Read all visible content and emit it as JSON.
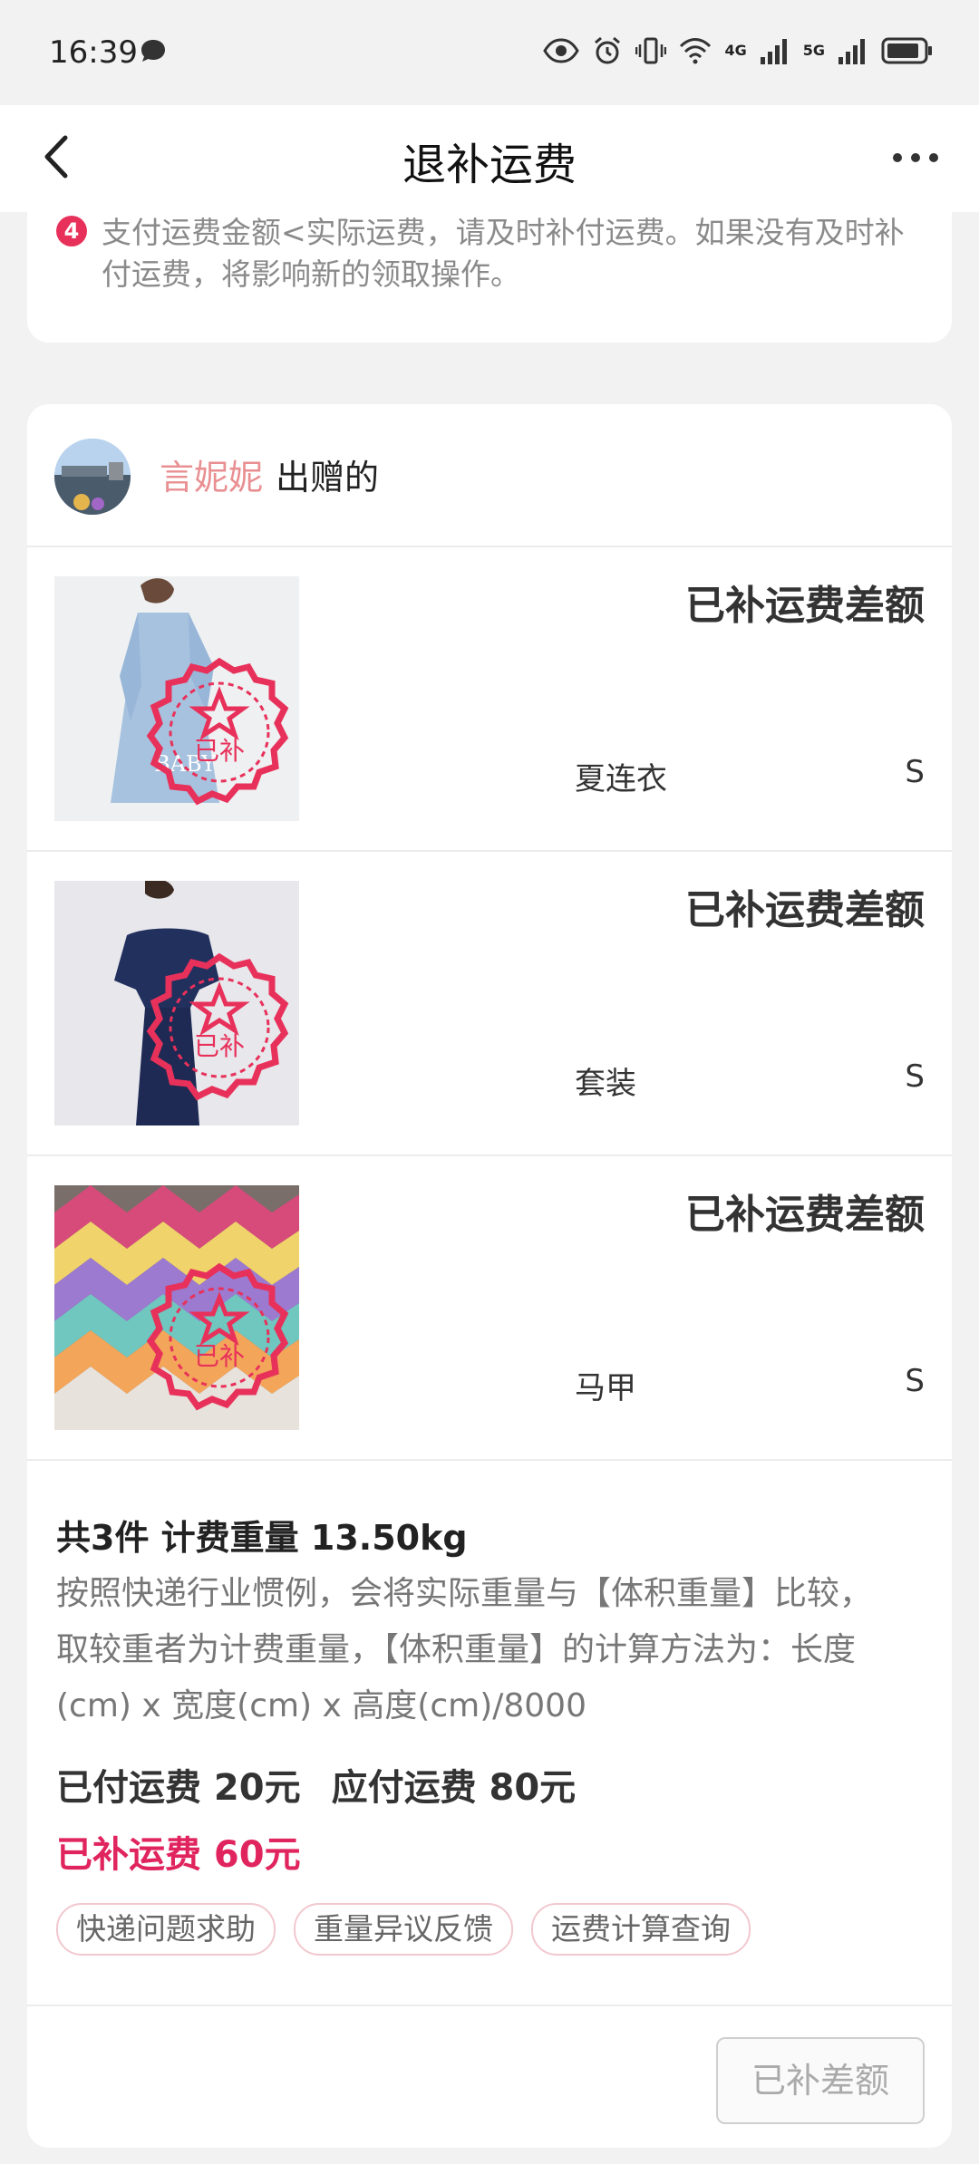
{
  "status_bar": {
    "time": "16:39",
    "network_1": "4G",
    "network_2": "5G"
  },
  "nav": {
    "title": "退补运费"
  },
  "notice": {
    "number": "4",
    "text": "支付运费金额<实际运费，请及时补付运费。如果没有及时补付运费，将影响新的领取操作。"
  },
  "giver": {
    "name": "言妮妮",
    "suffix": "出赠的"
  },
  "items": [
    {
      "status": "已补运费差额",
      "name": "夏连衣",
      "size": "S",
      "stamp": "已补",
      "watermark": "BABY"
    },
    {
      "status": "已补运费差额",
      "name": "套装",
      "size": "S",
      "stamp": "已补"
    },
    {
      "status": "已补运费差额",
      "name": "马甲",
      "size": "S",
      "stamp": "已补"
    }
  ],
  "summary": {
    "title": "共3件 计费重量 13.50kg",
    "description": "按照快递行业惯例，会将实际重量与【体积重量】比较，取较重者为计费重量，【体积重量】的计算方法为：长度(cm) x 宽度(cm) x 高度(cm)/8000",
    "paid": "已付运费 20元",
    "due": "应付运费 80元",
    "supplemented": "已补运费 60元"
  },
  "tags": [
    "快递问题求助",
    "重量异议反馈",
    "运费计算查询"
  ],
  "action_button": "已补差额",
  "colors": {
    "accent": "#e0245e",
    "giver_name": "#e98f92",
    "stamp": "#e8315a"
  }
}
